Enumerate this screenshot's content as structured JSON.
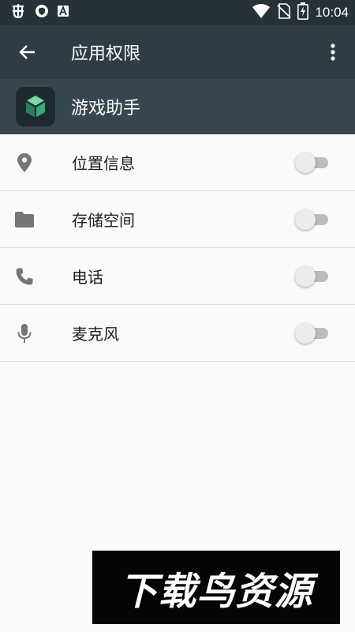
{
  "status_bar": {
    "time": "10:04",
    "icons_left": [
      "bug-icon",
      "shield-icon",
      "a-store-icon"
    ],
    "icons_right": [
      "wifi-icon",
      "no-sim-icon",
      "battery-charging-icon"
    ]
  },
  "app_bar": {
    "title": "应用权限",
    "back_icon": "arrow-left-icon",
    "menu_icon": "more-vert-icon"
  },
  "app_header": {
    "app_name": "游戏助手",
    "icon": "app-cube-icon"
  },
  "permissions": [
    {
      "label": "位置信息",
      "icon": "location-pin-icon",
      "enabled": false
    },
    {
      "label": "存储空间",
      "icon": "folder-icon",
      "enabled": false
    },
    {
      "label": "电话",
      "icon": "phone-icon",
      "enabled": false
    },
    {
      "label": "麦克风",
      "icon": "microphone-icon",
      "enabled": false
    }
  ],
  "watermark": {
    "text": "下载鸟资源"
  },
  "colors": {
    "status_bar": "#263238",
    "app_bar": "#2f3c43",
    "app_header": "#37474f",
    "background": "#fafafa",
    "divider": "#e0e0e0",
    "icon_gray": "#757575",
    "toggle_off_track": "#bdbdbd",
    "toggle_off_thumb": "#ececec"
  }
}
